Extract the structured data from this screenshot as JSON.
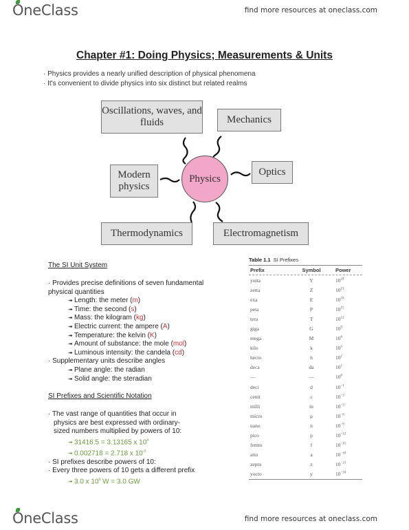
{
  "header": {
    "logo_text": "OneClass",
    "resources_text": "find more resources at oneclass.com"
  },
  "footer": {
    "logo_text": "OneClass",
    "resources_text": "find more resources at oneclass.com"
  },
  "title": "Chapter #1: Doing Physics; Measurements & Units",
  "intro_bullets": [
    "Physics provides a nearly unified description of physical phenomena",
    "It's convenient to divide physics into six distinct but related realms"
  ],
  "diagram": {
    "center": "Physics",
    "center_color": "#f2a6c8",
    "realms": {
      "oscillations": "Oscillations, waves, and fluids",
      "mechanics": "Mechanics",
      "modern": "Modern physics",
      "optics": "Optics",
      "thermo": "Thermodynamics",
      "em": "Electromagnetism"
    }
  },
  "si_section": {
    "heading": "The SI Unit System",
    "intro": "Provides precise definitions of seven fundamental physical quantities",
    "units": [
      {
        "text": "Length: the meter",
        "symbol": "m"
      },
      {
        "text": "Time: the second",
        "symbol": "s"
      },
      {
        "text": "Mass: the kilogram",
        "symbol": "kg"
      },
      {
        "text": "Electric current: the ampere",
        "symbol": "A"
      },
      {
        "text": "Temperature: the kelvin",
        "symbol": "K"
      },
      {
        "text": "Amount of substance: the mole",
        "symbol": "mol"
      },
      {
        "text": "Luminous intensity: the candela",
        "symbol": "cd"
      }
    ],
    "supplementary": "Supplementary units describe angles",
    "angles": [
      "Plane angle: the radian",
      "Solid angle: the steradian"
    ]
  },
  "prefix_section": {
    "heading": "SI Prefixes and Scientific Notation",
    "bullet1": "The vast range of quantities that occur in physics are best expressed with ordinary-sized numbers multiplied by powers of 10:",
    "examples": [
      {
        "lhs": "31416.5 = 3.13165 x 10",
        "exp": "4"
      },
      {
        "lhs": "0.002718 = 2.718 x 10",
        "exp": "-3"
      }
    ],
    "bullet2": "SI prefixes describe powers of 10:",
    "bullet3": "Every three powers of 10 gets a different prefix",
    "example3": {
      "pre": "3.0 x 10",
      "exp": "9",
      "post": " W = 3.0 GW"
    },
    "accent_color": "#6a9a3a",
    "unit_color": "#e03030"
  },
  "table": {
    "caption_bold": "Table 1.1",
    "caption": "SI Prefixes",
    "headers": [
      "Prefix",
      "Symbol",
      "Power"
    ],
    "rows": [
      [
        "yotta",
        "Y",
        "24"
      ],
      [
        "zetta",
        "Z",
        "21"
      ],
      [
        "exa",
        "E",
        "18"
      ],
      [
        "peta",
        "P",
        "15"
      ],
      [
        "tera",
        "T",
        "12"
      ],
      [
        "giga",
        "G",
        "9"
      ],
      [
        "mega",
        "M",
        "6"
      ],
      [
        "kilo",
        "k",
        "3"
      ],
      [
        "hecto",
        "h",
        "2"
      ],
      [
        "deca",
        "da",
        "1"
      ],
      [
        "—",
        "—",
        "0"
      ],
      [
        "deci",
        "d",
        "−1"
      ],
      [
        "centi",
        "c",
        "−2"
      ],
      [
        "milli",
        "m",
        "−3"
      ],
      [
        "micro",
        "μ",
        "−6"
      ],
      [
        "nano",
        "n",
        "−9"
      ],
      [
        "pico",
        "p",
        "−12"
      ],
      [
        "femto",
        "f",
        "−15"
      ],
      [
        "atto",
        "a",
        "−18"
      ],
      [
        "zepto",
        "z",
        "−21"
      ],
      [
        "yocto",
        "y",
        "−24"
      ]
    ]
  }
}
